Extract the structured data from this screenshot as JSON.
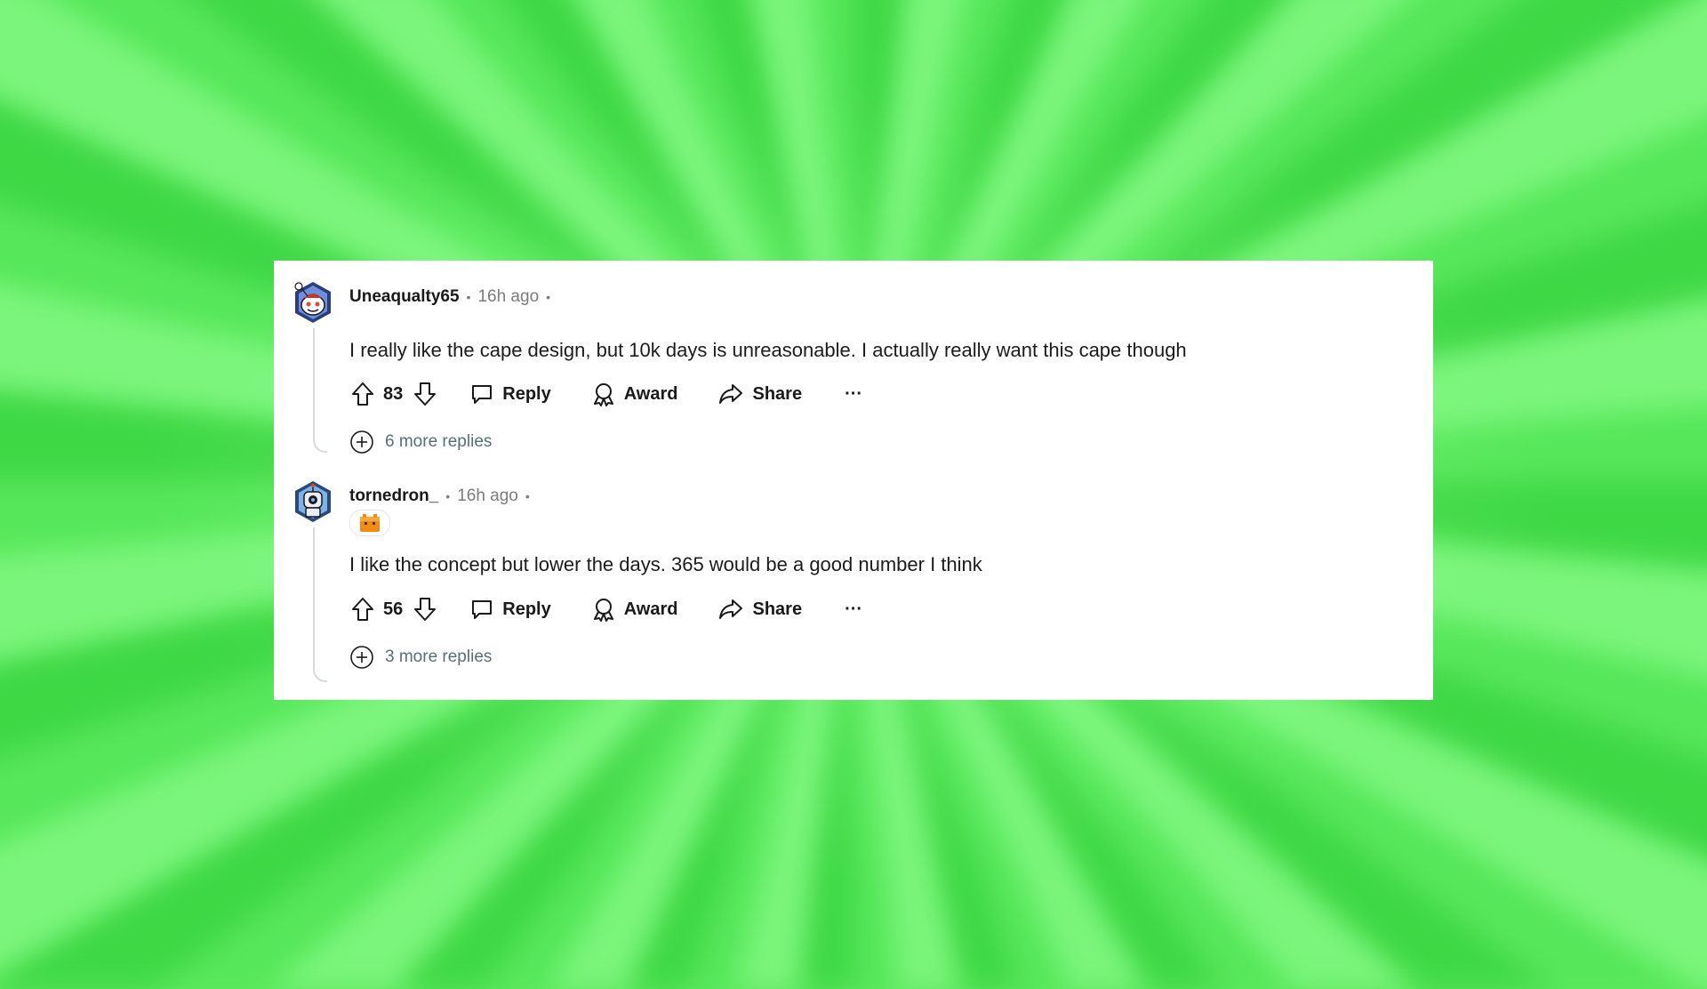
{
  "colors": {
    "background": "#5ee85f",
    "card": "#ffffff",
    "username": "#1a1a1b",
    "timestamp": "#7c7c7c",
    "thread_line": "#d7dadc",
    "more_replies_text": "#576f76"
  },
  "comments": [
    {
      "avatar_icon": "snoo-avatar-icon",
      "username": "Uneaqualty65",
      "separator": "•",
      "time": "16h ago",
      "trailing_dot": "•",
      "flair_icon": null,
      "text": "I really like the cape design, but 10k days is unreasonable. I actually really want this cape though",
      "score": "83",
      "actions": {
        "reply": "Reply",
        "award": "Award",
        "share": "Share",
        "more": "···"
      },
      "more_replies": "6 more replies"
    },
    {
      "avatar_icon": "robot-avatar-icon",
      "username": "tornedron_",
      "separator": "•",
      "time": "16h ago",
      "trailing_dot": "•",
      "flair_icon": "orange-block-flair-icon",
      "text": "I like the concept but lower the days. 365 would be a good number I think",
      "score": "56",
      "actions": {
        "reply": "Reply",
        "award": "Award",
        "share": "Share",
        "more": "···"
      },
      "more_replies": "3 more replies"
    }
  ]
}
